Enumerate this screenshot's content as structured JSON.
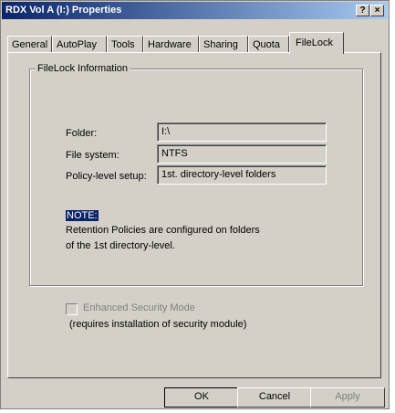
{
  "window": {
    "title": "RDX Vol A (I:) Properties",
    "help_glyph": "?",
    "close_glyph": "×"
  },
  "tabs": [
    {
      "label": "General"
    },
    {
      "label": "AutoPlay"
    },
    {
      "label": "Tools"
    },
    {
      "label": "Hardware"
    },
    {
      "label": "Sharing"
    },
    {
      "label": "Quota"
    },
    {
      "label": "FileLock",
      "active": true
    }
  ],
  "filelock": {
    "group_title": "FileLock Information",
    "folder_label": "Folder:",
    "folder_value": "I:\\",
    "filesystem_label": "File system:",
    "filesystem_value": "NTFS",
    "policy_label": "Policy-level setup:",
    "policy_value": "1st. directory-level folders",
    "note_title": "NOTE:",
    "note_line1": "Retention Policies are configured on folders",
    "note_line2": "of the 1st directory-level."
  },
  "security": {
    "checkbox_label": "Enhanced Security Mode",
    "checkbox_checked": false,
    "subtext": "(requires installation of security module)"
  },
  "buttons": {
    "ok": "OK",
    "cancel": "Cancel",
    "apply": "Apply"
  }
}
